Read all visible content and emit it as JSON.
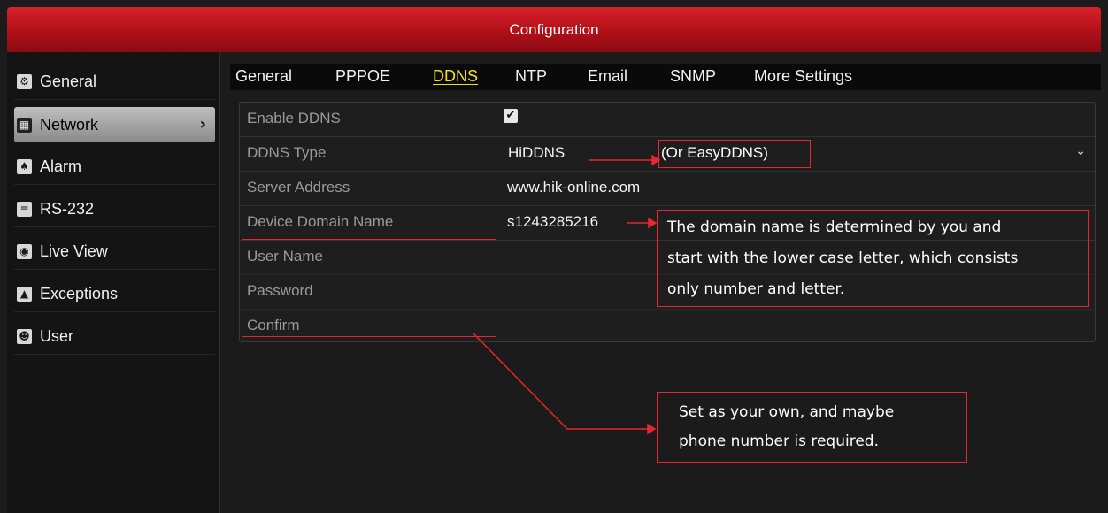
{
  "window": {
    "title": "Configuration"
  },
  "sidebar": {
    "items": [
      {
        "label": "General",
        "icon": "gear-icon",
        "glyph": "⚙"
      },
      {
        "label": "Network",
        "icon": "network-icon",
        "glyph": "▦",
        "active": true
      },
      {
        "label": "Alarm",
        "icon": "alarm-icon",
        "glyph": "♠"
      },
      {
        "label": "RS-232",
        "icon": "serial-port-icon",
        "glyph": "≡"
      },
      {
        "label": "Live View",
        "icon": "eye-icon",
        "glyph": "◉"
      },
      {
        "label": "Exceptions",
        "icon": "warning-icon",
        "glyph": "▲"
      },
      {
        "label": "User",
        "icon": "users-icon",
        "glyph": "☻"
      }
    ],
    "active_arrow": "›"
  },
  "tabs": [
    {
      "label": "General"
    },
    {
      "label": "PPPOE"
    },
    {
      "label": "DDNS",
      "active": true
    },
    {
      "label": "NTP"
    },
    {
      "label": "Email"
    },
    {
      "label": "SNMP"
    },
    {
      "label": "More Settings"
    }
  ],
  "form": {
    "enable_ddns": {
      "label": "Enable DDNS",
      "checked": true,
      "check_glyph": "✔"
    },
    "ddns_type": {
      "label": "DDNS Type",
      "value": "HiDDNS",
      "caret": "⌄"
    },
    "server_address": {
      "label": "Server Address",
      "value": "www.hik-online.com"
    },
    "device_domain": {
      "label": "Device Domain Name",
      "value": "s1243285216"
    },
    "user_name": {
      "label": "User Name",
      "value": ""
    },
    "password": {
      "label": "Password",
      "value": ""
    },
    "confirm": {
      "label": "Confirm",
      "value": ""
    }
  },
  "annotations": {
    "or_easyddns": "(Or EasyDDNS)",
    "domain_note_lines": [
      "The domain name is determined by you and",
      "start with the lower case letter, which consists",
      "only number and letter."
    ],
    "credentials_note_lines": [
      "Set as your own, and maybe",
      "phone number is required."
    ],
    "annotation_color": "#e8262f"
  },
  "colors": {
    "title_red": "#c4161f",
    "active_tab": "#f2e01a",
    "label_gray": "#9a9a9a"
  }
}
